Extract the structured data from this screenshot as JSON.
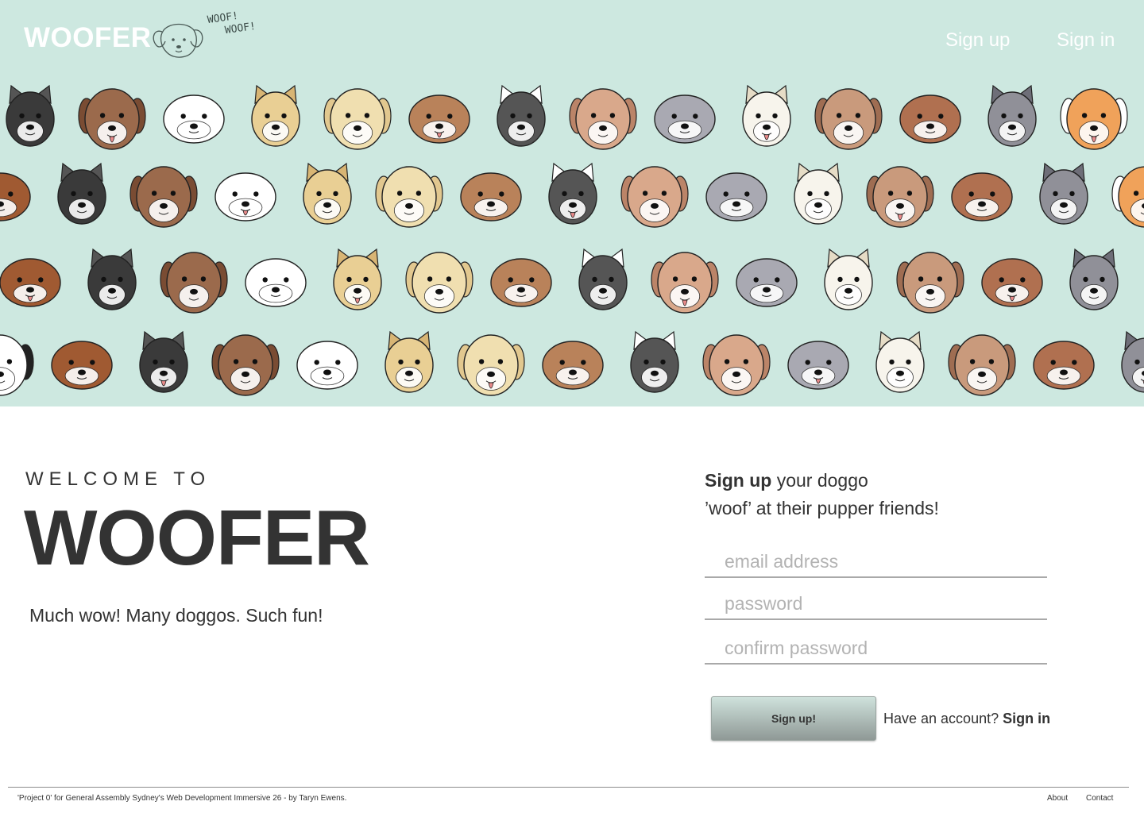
{
  "header": {
    "logo": "WOOFER",
    "logo_bubble": [
      "WOOF!",
      "WOOF!"
    ],
    "nav": {
      "signup": "Sign up",
      "signin": "Sign in"
    }
  },
  "hero": {
    "background": "#cde8e0",
    "pattern_icon": "dog-faces-pattern"
  },
  "welcome": {
    "kicker": "WELCOME TO",
    "title": "WOOFER",
    "tagline": "Much wow! Many doggos. Such fun!"
  },
  "signup_form": {
    "intro_bold": "Sign up",
    "intro_rest": "your doggo",
    "intro_line2": "’woof’ at their pupper friends!",
    "email_placeholder": "email address",
    "password_placeholder": "password",
    "confirm_placeholder": "confirm password",
    "submit_label": "Sign up!",
    "have_account_text": "Have an account?",
    "signin_link": "Sign in"
  },
  "footer": {
    "credit": "'Project 0' for General Assembly Sydney's Web Development Immersive 26 - by Taryn Ewens.",
    "about": "About",
    "contact": "Contact"
  }
}
